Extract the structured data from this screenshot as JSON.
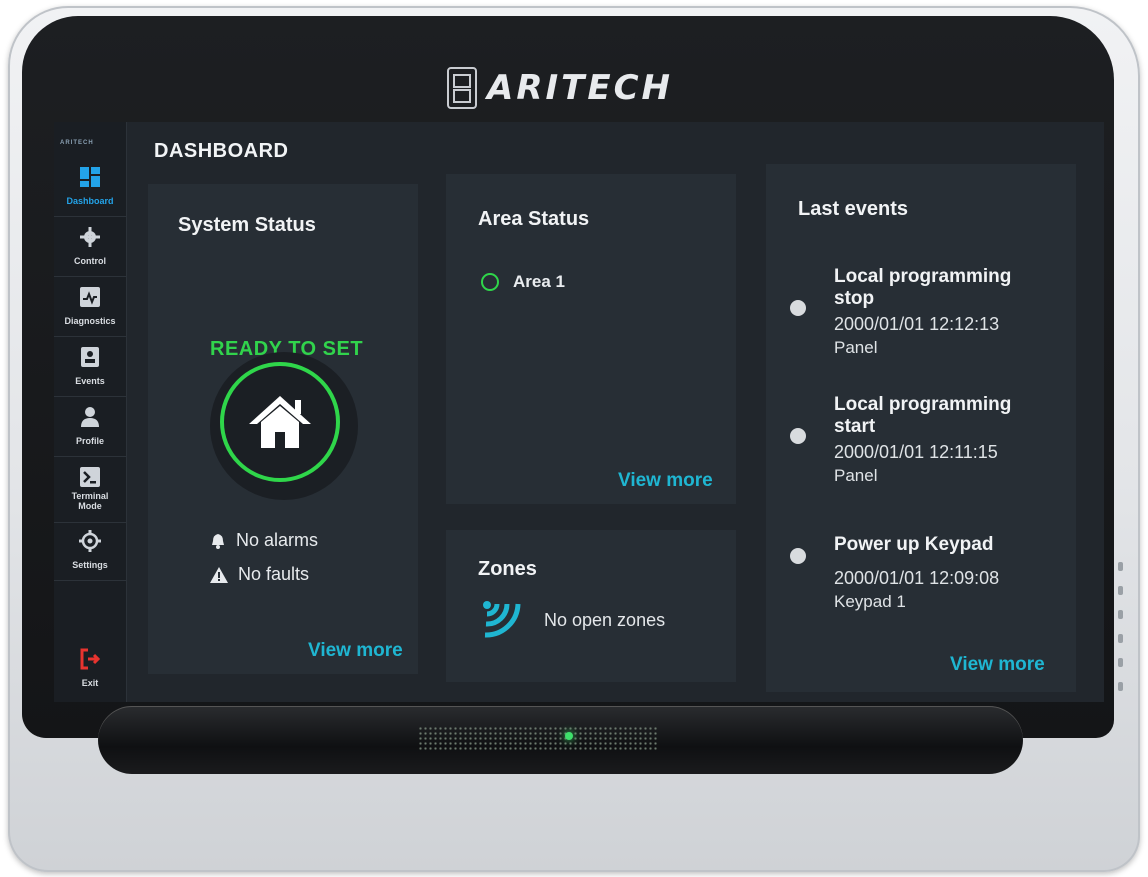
{
  "brand": {
    "name": "ARITECH",
    "sidebar_logo": "ARITECH"
  },
  "sidebar": {
    "items": [
      {
        "label": "Dashboard",
        "icon": "dashboard-icon",
        "active": true
      },
      {
        "label": "Control",
        "icon": "gear-icon"
      },
      {
        "label": "Diagnostics",
        "icon": "diagnostics-icon"
      },
      {
        "label": "Events",
        "icon": "events-icon"
      },
      {
        "label": "Profile",
        "icon": "profile-icon"
      },
      {
        "label": "Terminal Mode",
        "icon": "terminal-icon"
      },
      {
        "label": "Settings",
        "icon": "settings-icon"
      }
    ],
    "exit": {
      "label": "Exit",
      "icon": "exit-icon"
    }
  },
  "page": {
    "title": "DASHBOARD"
  },
  "system_status": {
    "title": "System Status",
    "state": "READY TO SET",
    "icon": "home-icon",
    "alarms": "No alarms",
    "faults": "No faults",
    "view_more": "View more"
  },
  "area_status": {
    "title": "Area Status",
    "areas": [
      {
        "name": "Area 1"
      }
    ],
    "view_more": "View more"
  },
  "zones": {
    "title": "Zones",
    "status": "No open zones",
    "icon": "wireless-icon"
  },
  "last_events": {
    "title": "Last events",
    "events": [
      {
        "title": "Local programming stop",
        "time": "2000/01/01 12:12:13",
        "source": "Panel"
      },
      {
        "title": "Local programming start",
        "time": "2000/01/01 12:11:15",
        "source": "Panel"
      },
      {
        "title": "Power up Keypad",
        "time": "2000/01/01 12:09:08",
        "source": "Keypad 1"
      }
    ],
    "view_more": "View more"
  },
  "colors": {
    "accent_blue": "#23a3e8",
    "ready_green": "#31d34c",
    "link_cyan": "#1fb6d2",
    "exit_red": "#e8342f"
  }
}
